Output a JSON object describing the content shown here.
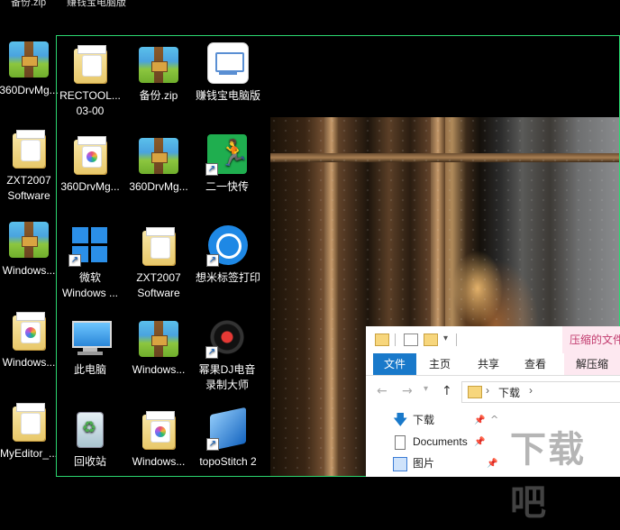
{
  "top_strip": {
    "left_cutoff": "备份.zip",
    "right_cutoff": "赚钱宝电脑版"
  },
  "left_column": [
    {
      "label": "360DrvMg...",
      "icon": "zip-archive-icon"
    },
    {
      "label": "ZXT2007\nSoftware",
      "icon": "folder-icon"
    },
    {
      "label": "Windows...",
      "icon": "zip-archive-icon"
    },
    {
      "label": "Windows...",
      "icon": "folder-icon"
    },
    {
      "label": "MyEditor_...",
      "icon": "folder-icon"
    }
  ],
  "grid_icons": [
    {
      "label": "RECTOOL...\n03-00",
      "icon": "folder-icon"
    },
    {
      "label": "备份.zip",
      "icon": "zip-archive-icon"
    },
    {
      "label": "赚钱宝电脑版",
      "icon": "zhuanqianbao-app-icon"
    },
    {
      "label": "360DrvMg...",
      "icon": "folder-icon"
    },
    {
      "label": "360DrvMg...",
      "icon": "zip-archive-icon"
    },
    {
      "label": "二一快传",
      "icon": "kuaichuan-app-icon"
    },
    {
      "label": "微软\nWindows ...",
      "icon": "windows-logo-icon"
    },
    {
      "label": "ZXT2007\nSoftware",
      "icon": "folder-icon"
    },
    {
      "label": "想米标签打印",
      "icon": "label-print-app-icon"
    },
    {
      "label": "此电脑",
      "icon": "this-pc-icon"
    },
    {
      "label": "Windows...",
      "icon": "zip-archive-icon"
    },
    {
      "label": "幂果DJ电音\n录制大师",
      "icon": "dj-record-app-icon"
    },
    {
      "label": "回收站",
      "icon": "recycle-bin-icon"
    },
    {
      "label": "Windows...",
      "icon": "folder-icon"
    },
    {
      "label": "topoStitch 2",
      "icon": "topostitch-app-icon"
    }
  ],
  "explorer": {
    "context_tab": "压缩的文件",
    "ribbon_tabs": [
      "文件",
      "主页",
      "共享",
      "查看",
      "解压缩"
    ],
    "address_path": "下载",
    "nav_items": [
      {
        "label": "下载",
        "icon": "download-arrow-icon",
        "pinned": true
      },
      {
        "label": "Documents",
        "icon": "documents-icon",
        "pinned": true
      },
      {
        "label": "图片",
        "icon": "pictures-icon",
        "pinned": true
      }
    ]
  },
  "watermark": "下载吧",
  "colors": {
    "selection_border": "#2bd66f",
    "ribbon_file_tab": "#1979ca",
    "context_tab_bg": "#fde8f0",
    "context_tab_text": "#c23b6e"
  }
}
